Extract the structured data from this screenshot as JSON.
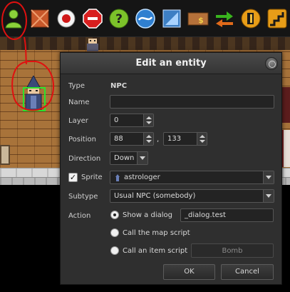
{
  "toolbar": {
    "icons": [
      "npc-icon",
      "block-icon",
      "destination-icon",
      "stop-icon",
      "help-icon",
      "teletransporter-icon",
      "sensor-icon",
      "shop-icon",
      "switch-arrows-icon",
      "door-icon",
      "stairs-icon"
    ]
  },
  "dialog": {
    "title": "Edit an entity",
    "type_label": "Type",
    "type_value": "NPC",
    "name_label": "Name",
    "name_value": "",
    "layer_label": "Layer",
    "layer_value": "0",
    "position_label": "Position",
    "position_x": "88",
    "position_sep": ",",
    "position_y": "133",
    "direction_label": "Direction",
    "direction_value": "Down",
    "sprite_label": "Sprite",
    "sprite_checked": true,
    "sprite_value": "astrologer",
    "subtype_label": "Subtype",
    "subtype_value": "Usual NPC (somebody)",
    "action_label": "Action",
    "action_options": [
      {
        "label": "Show a dialog",
        "selected": true
      },
      {
        "label": "Call the map script",
        "selected": false
      },
      {
        "label": "Call an item script",
        "selected": false
      }
    ],
    "dialog_value": "_dialog.test",
    "item_value": "Bomb",
    "ok_label": "OK",
    "cancel_label": "Cancel"
  },
  "colors": {
    "annotation": "#e01010",
    "selection": "#2be32b",
    "dialog_bg": "#2f2f2f"
  }
}
